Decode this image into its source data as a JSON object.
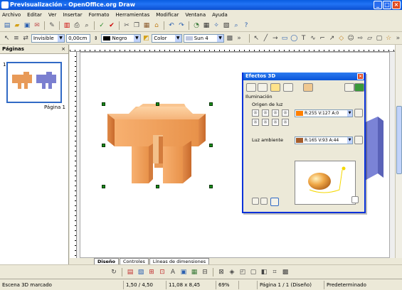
{
  "window": {
    "title": "Previsualización - OpenOffice.org Draw",
    "min": "_",
    "max": "□",
    "close": "×"
  },
  "menu": [
    "Archivo",
    "Editar",
    "Ver",
    "Insertar",
    "Formato",
    "Herramientas",
    "Modificar",
    "Ventana",
    "Ayuda"
  ],
  "toolbar2": {
    "line_style": "Invisible",
    "line_width": "0,00cm",
    "line_color": "Negro",
    "fill_type": "Color",
    "fill_value": "Sun 4"
  },
  "pages_panel": {
    "title": "Páginas",
    "close": "×",
    "page_number": "1",
    "page_label": "Página 1"
  },
  "tabs": [
    "Diseño",
    "Controles",
    "Líneas de dimensiones"
  ],
  "dialog": {
    "title": "Efectos 3D",
    "close": "×",
    "section": "Iluminación",
    "light_source_label": "Origen de luz",
    "light_color": "R:255 V:127 A:0",
    "ambient_label": "Luz ambiente",
    "ambient_color": "R:165 V:93 A:44"
  },
  "status": {
    "selection": "Escena 3D marcado",
    "position": "1,50 / 4,50",
    "size": "11,08 x 8,45",
    "zoom": "69%",
    "page": "Página 1 / 1 (Diseño)",
    "layout": "Predeterminado"
  },
  "colors": {
    "light": "#ff7f00",
    "ambient": "#a55d2c",
    "object": "#f0a868",
    "title_blue": "#0a55d8"
  }
}
